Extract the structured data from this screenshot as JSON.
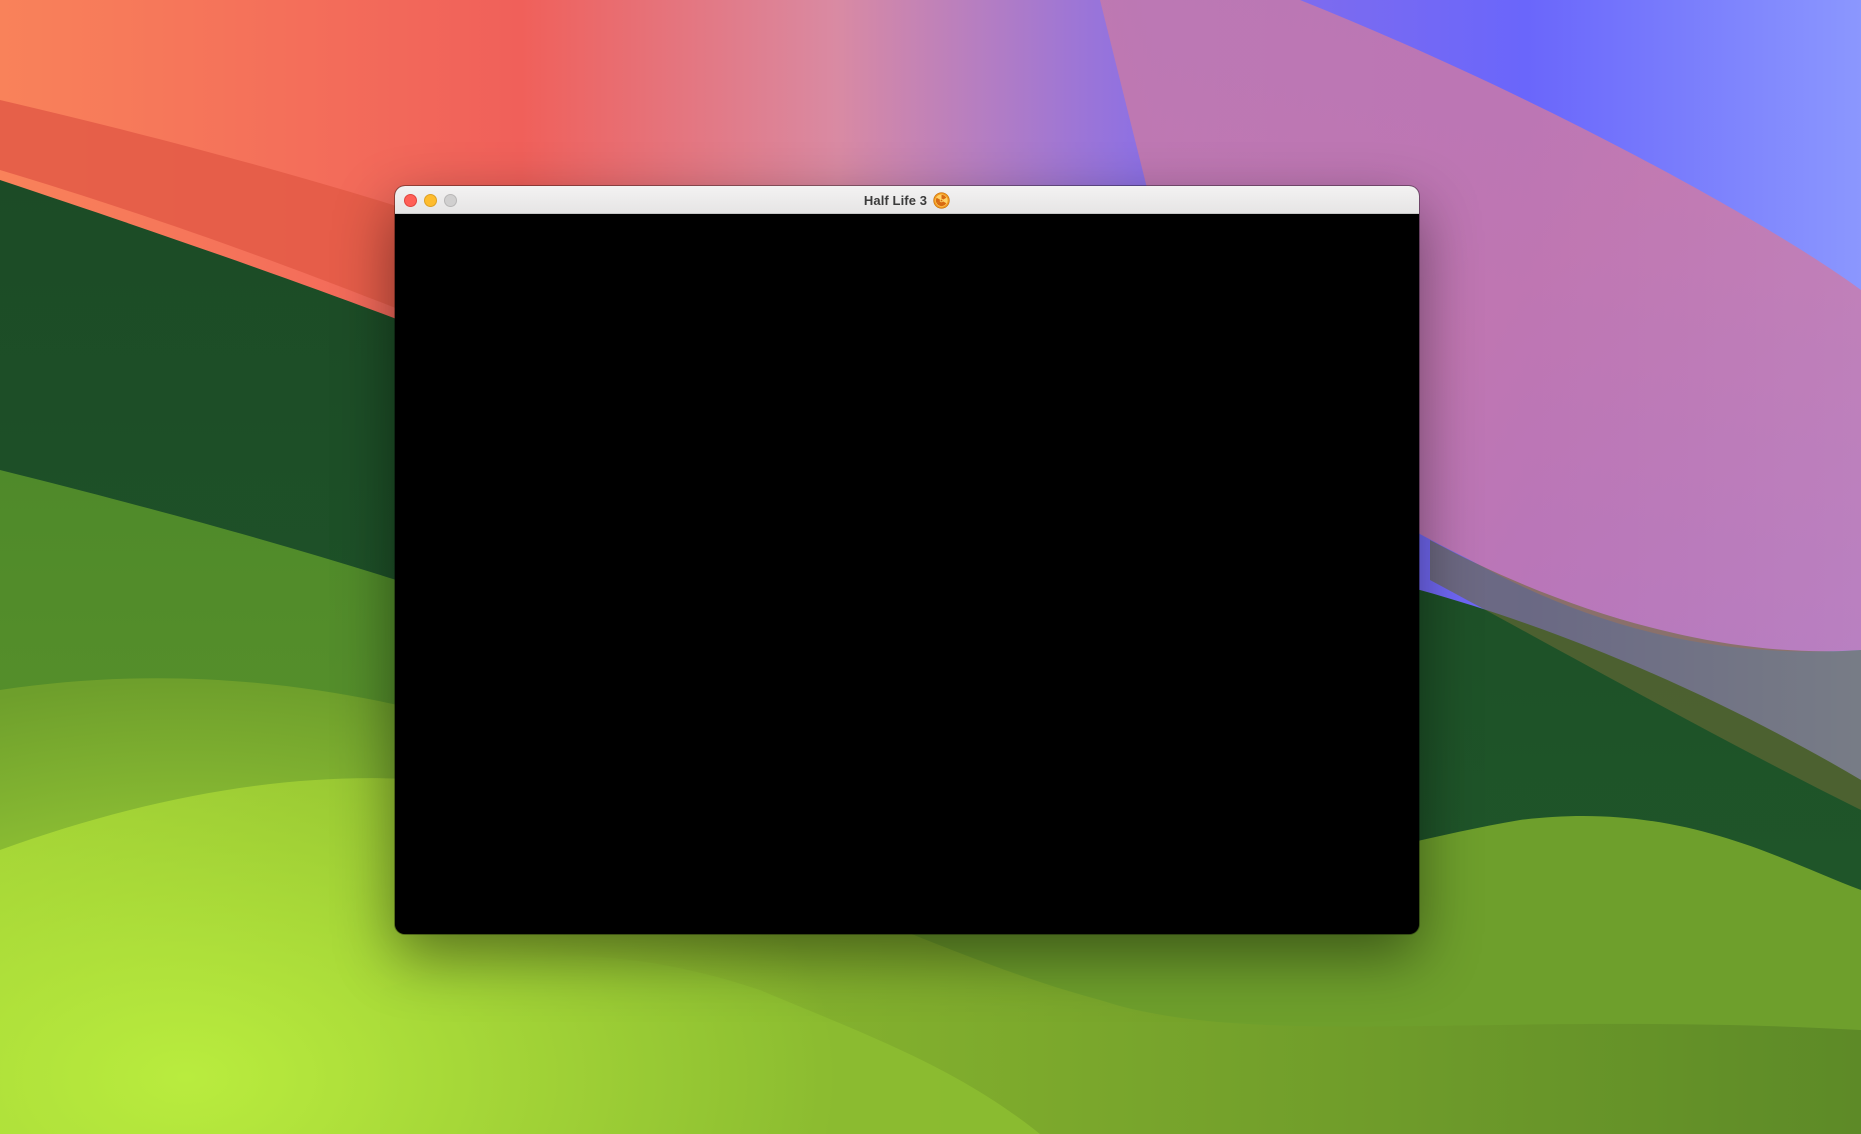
{
  "window": {
    "title": "Half Life 3",
    "title_icon": "radiation-icon",
    "controls": [
      "close",
      "minimize",
      "zoom"
    ],
    "content_color": "#000000"
  },
  "colors": {
    "traffic_close": "#ff5f57",
    "traffic_minimize": "#febc2e",
    "traffic_zoom_disabled": "#d0cfcf",
    "title_icon_accent": "#f29a1f"
  }
}
